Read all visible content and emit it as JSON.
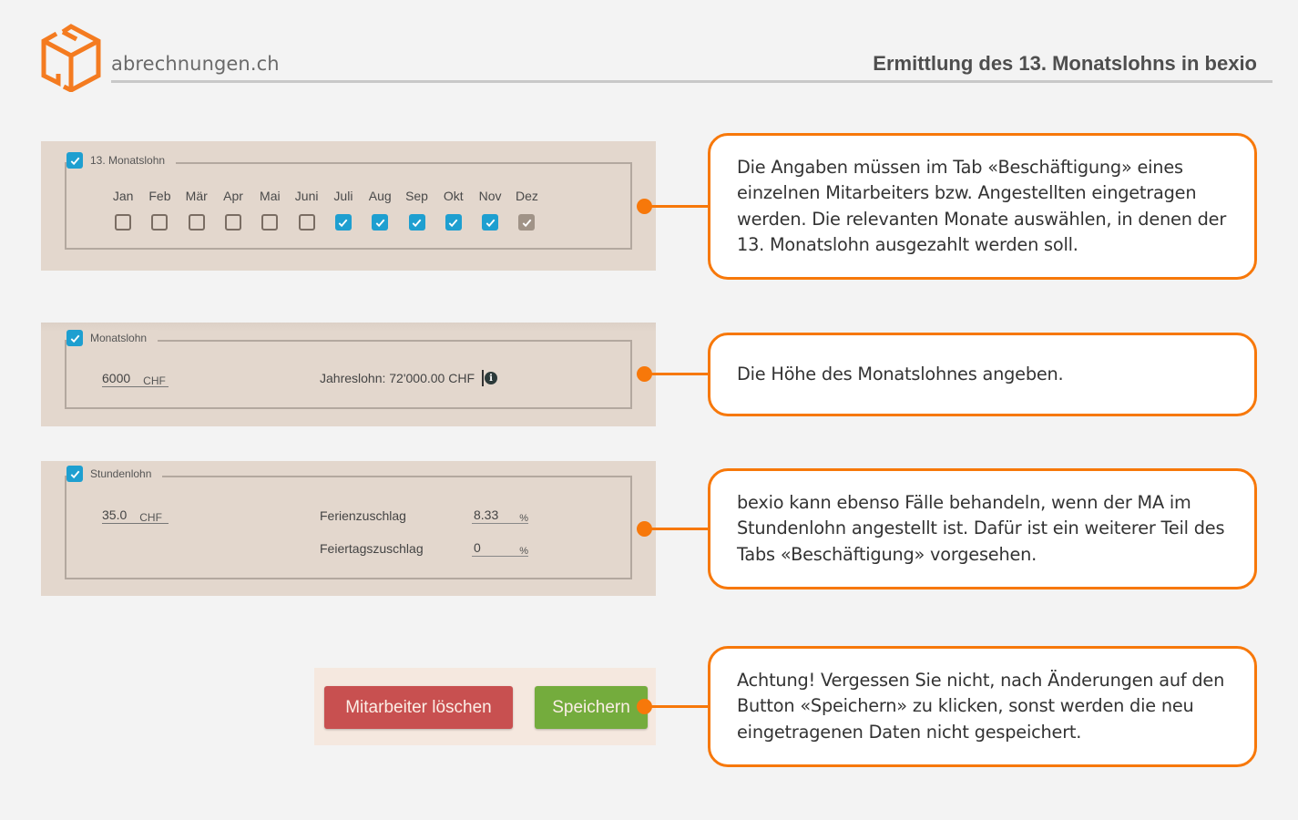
{
  "header": {
    "brand": "abrechnungen.ch",
    "title": "Ermittlung des 13. Monatslohns in bexio",
    "logo_icon": "cube-icon",
    "accent_color": "#f7780a"
  },
  "section_13th_salary": {
    "label": "13. Monatslohn",
    "checked": true,
    "months": [
      {
        "label": "Jan",
        "checked": false
      },
      {
        "label": "Feb",
        "checked": false
      },
      {
        "label": "Mär",
        "checked": false
      },
      {
        "label": "Apr",
        "checked": false
      },
      {
        "label": "Mai",
        "checked": false
      },
      {
        "label": "Juni",
        "checked": false
      },
      {
        "label": "Juli",
        "checked": true
      },
      {
        "label": "Aug",
        "checked": true
      },
      {
        "label": "Sep",
        "checked": true
      },
      {
        "label": "Okt",
        "checked": true
      },
      {
        "label": "Nov",
        "checked": true
      },
      {
        "label": "Dez",
        "checked": true,
        "disabled": true
      }
    ]
  },
  "section_monthly": {
    "label": "Monatslohn",
    "checked": true,
    "value": "6000",
    "unit": "CHF",
    "annual_text": "Jahreslohn: 72'000.00 CHF",
    "info_icon": "info-icon"
  },
  "section_hourly": {
    "label": "Stundenlohn",
    "checked": true,
    "value": "35.0",
    "unit": "CHF",
    "vacation_label": "Ferienzuschlag",
    "vacation_value": "8.33",
    "vacation_unit": "%",
    "holiday_label": "Feiertagszuschlag",
    "holiday_value": "0",
    "holiday_unit": "%"
  },
  "buttons": {
    "delete_label": "Mitarbeiter löschen",
    "save_label": "Speichern",
    "delete_color": "#c85050",
    "save_color": "#74ac3d"
  },
  "callouts": [
    "Die Angaben müssen im Tab «Beschäftigung» eines einzelnen Mitarbeiters bzw. Angestellten eingetragen werden. Die relevanten Monate auswählen, in denen der 13. Monatslohn ausgezahlt werden soll.",
    "Die Höhe des Monatslohnes angeben.",
    "bexio kann ebenso Fälle behandeln, wenn der MA im Stundenlohn angestellt ist. Dafür ist ein weiterer Teil des Tabs «Beschäftigung» vorgesehen.",
    "Achtung! Vergessen Sie nicht, nach Änderungen auf den Button «Speichern» zu klicken, sonst werden die neu eingetragenen Daten nicht gespeichert."
  ]
}
